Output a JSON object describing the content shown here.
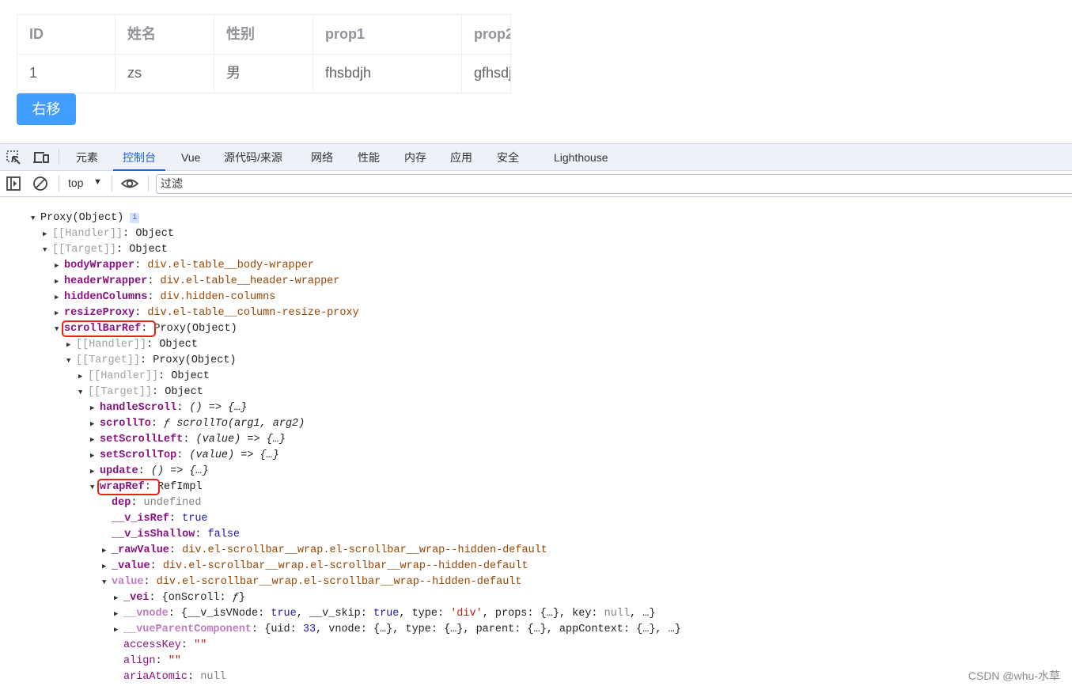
{
  "table": {
    "headers": [
      "ID",
      "姓名",
      "性别",
      "prop1",
      "prop2"
    ],
    "rows": [
      [
        "1",
        "zs",
        "男",
        "fhsbdjh",
        "gfhsdj"
      ]
    ]
  },
  "button": {
    "label": "右移",
    "color": "#409eff"
  },
  "devtools": {
    "tabs": [
      "元素",
      "控制台",
      "Vue",
      "源代码/来源",
      "网络",
      "性能",
      "内存",
      "应用",
      "安全",
      "Lighthouse"
    ],
    "active_tab": "控制台",
    "context": "top",
    "filter_placeholder": "过滤"
  },
  "console": {
    "rows": [
      {
        "level": 0,
        "arrow": "open",
        "key": "",
        "value": [
          {
            "t": "Proxy(Object)",
            "c": "obj"
          }
        ],
        "badge": "i"
      },
      {
        "level": 1,
        "arrow": "closed",
        "key": "[[Handler]]",
        "kc": "nb",
        "value": [
          {
            "t": "Object",
            "c": "obj"
          }
        ]
      },
      {
        "level": 1,
        "arrow": "open",
        "key": "[[Target]]",
        "kc": "nb",
        "value": [
          {
            "t": "Object",
            "c": "obj"
          }
        ]
      },
      {
        "level": 2,
        "arrow": "closed",
        "key": "bodyWrapper",
        "value": [
          {
            "t": "div.el-table__body-wrapper",
            "c": "cls"
          }
        ]
      },
      {
        "level": 2,
        "arrow": "closed",
        "key": "headerWrapper",
        "value": [
          {
            "t": "div.el-table__header-wrapper",
            "c": "cls"
          }
        ]
      },
      {
        "level": 2,
        "arrow": "closed",
        "key": "hiddenColumns",
        "value": [
          {
            "t": "div.hidden-columns",
            "c": "cls"
          }
        ]
      },
      {
        "level": 2,
        "arrow": "closed",
        "key": "resizeProxy",
        "value": [
          {
            "t": "div.el-table__column-resize-proxy",
            "c": "cls"
          }
        ]
      },
      {
        "level": 2,
        "arrow": "open",
        "key": "scrollBarRef",
        "boxed": true,
        "value": [
          {
            "t": "Proxy(Object)",
            "c": "obj"
          }
        ]
      },
      {
        "level": 3,
        "arrow": "closed",
        "key": "[[Handler]]",
        "kc": "nb",
        "value": [
          {
            "t": "Object",
            "c": "obj"
          }
        ]
      },
      {
        "level": 3,
        "arrow": "open",
        "key": "[[Target]]",
        "kc": "nb",
        "value": [
          {
            "t": "Proxy(Object)",
            "c": "obj"
          }
        ]
      },
      {
        "level": 4,
        "arrow": "closed",
        "key": "[[Handler]]",
        "kc": "nb",
        "value": [
          {
            "t": "Object",
            "c": "obj"
          }
        ]
      },
      {
        "level": 4,
        "arrow": "open",
        "key": "[[Target]]",
        "kc": "nb",
        "value": [
          {
            "t": "Object",
            "c": "obj"
          }
        ]
      },
      {
        "level": 5,
        "arrow": "closed",
        "key": "handleScroll",
        "value": [
          {
            "t": "() => {…}",
            "c": "it"
          }
        ]
      },
      {
        "level": 5,
        "arrow": "closed",
        "key": "scrollTo",
        "value": [
          {
            "t": "ƒ scrollTo(arg1, arg2)",
            "c": "it"
          }
        ]
      },
      {
        "level": 5,
        "arrow": "closed",
        "key": "setScrollLeft",
        "value": [
          {
            "t": "(value) => {…}",
            "c": "it"
          }
        ]
      },
      {
        "level": 5,
        "arrow": "closed",
        "key": "setScrollTop",
        "value": [
          {
            "t": "(value) => {…}",
            "c": "it"
          }
        ]
      },
      {
        "level": 5,
        "arrow": "closed",
        "key": "update",
        "value": [
          {
            "t": "() => {…}",
            "c": "it"
          }
        ]
      },
      {
        "level": 5,
        "arrow": "open",
        "key": "wrapRef",
        "boxed": true,
        "value": [
          {
            "t": "RefImpl",
            "c": "obj"
          }
        ]
      },
      {
        "level": 6,
        "arrow": "none",
        "key": "dep",
        "value": [
          {
            "t": "undefined",
            "c": "null"
          }
        ]
      },
      {
        "level": 6,
        "arrow": "none",
        "key": "__v_isRef",
        "value": [
          {
            "t": "true",
            "c": "kw"
          }
        ]
      },
      {
        "level": 6,
        "arrow": "none",
        "key": "__v_isShallow",
        "value": [
          {
            "t": "false",
            "c": "kw"
          }
        ]
      },
      {
        "level": 6,
        "arrow": "closed",
        "key": "_rawValue",
        "value": [
          {
            "t": "div.el-scrollbar__wrap.el-scrollbar__wrap--hidden-default",
            "c": "cls"
          }
        ]
      },
      {
        "level": 6,
        "arrow": "closed",
        "key": "_value",
        "value": [
          {
            "t": "div.el-scrollbar__wrap.el-scrollbar__wrap--hidden-default",
            "c": "cls"
          }
        ]
      },
      {
        "level": 6,
        "arrow": "open",
        "key": "value",
        "kc": "light",
        "value": [
          {
            "t": "div.el-scrollbar__wrap.el-scrollbar__wrap--hidden-default",
            "c": "cls"
          }
        ]
      },
      {
        "level": 7,
        "arrow": "closed",
        "key": "_vei",
        "value": [
          {
            "t": "{onScroll: ",
            "c": "obj"
          },
          {
            "t": "ƒ",
            "c": "it"
          },
          {
            "t": "}",
            "c": "obj"
          }
        ]
      },
      {
        "level": 7,
        "arrow": "closed",
        "key": "__vnode",
        "kc": "light",
        "value": [
          {
            "t": "{__v_isVNode: ",
            "c": "obj"
          },
          {
            "t": "true",
            "c": "kw"
          },
          {
            "t": ", __v_skip: ",
            "c": "obj"
          },
          {
            "t": "true",
            "c": "kw"
          },
          {
            "t": ", type: ",
            "c": "obj"
          },
          {
            "t": "'div'",
            "c": "str"
          },
          {
            "t": ", props: {…}, key: ",
            "c": "obj"
          },
          {
            "t": "null",
            "c": "null"
          },
          {
            "t": ", …}",
            "c": "obj"
          }
        ]
      },
      {
        "level": 7,
        "arrow": "closed",
        "key": "__vueParentComponent",
        "kc": "light",
        "value": [
          {
            "t": "{uid: ",
            "c": "obj"
          },
          {
            "t": "33",
            "c": "num"
          },
          {
            "t": ", vnode: {…}, type: {…}, parent: {…}, appContext: {…}, …}",
            "c": "obj"
          }
        ]
      },
      {
        "level": 7,
        "arrow": "none",
        "key": "accessKey",
        "kc": "plain",
        "value": [
          {
            "t": "\"\"",
            "c": "str"
          }
        ]
      },
      {
        "level": 7,
        "arrow": "none",
        "key": "align",
        "kc": "plain",
        "value": [
          {
            "t": "\"\"",
            "c": "str"
          }
        ]
      },
      {
        "level": 7,
        "arrow": "none",
        "key": "ariaAtomic",
        "kc": "plain",
        "value": [
          {
            "t": "null",
            "c": "null"
          }
        ]
      }
    ]
  },
  "watermark": "CSDN @whu-水草"
}
